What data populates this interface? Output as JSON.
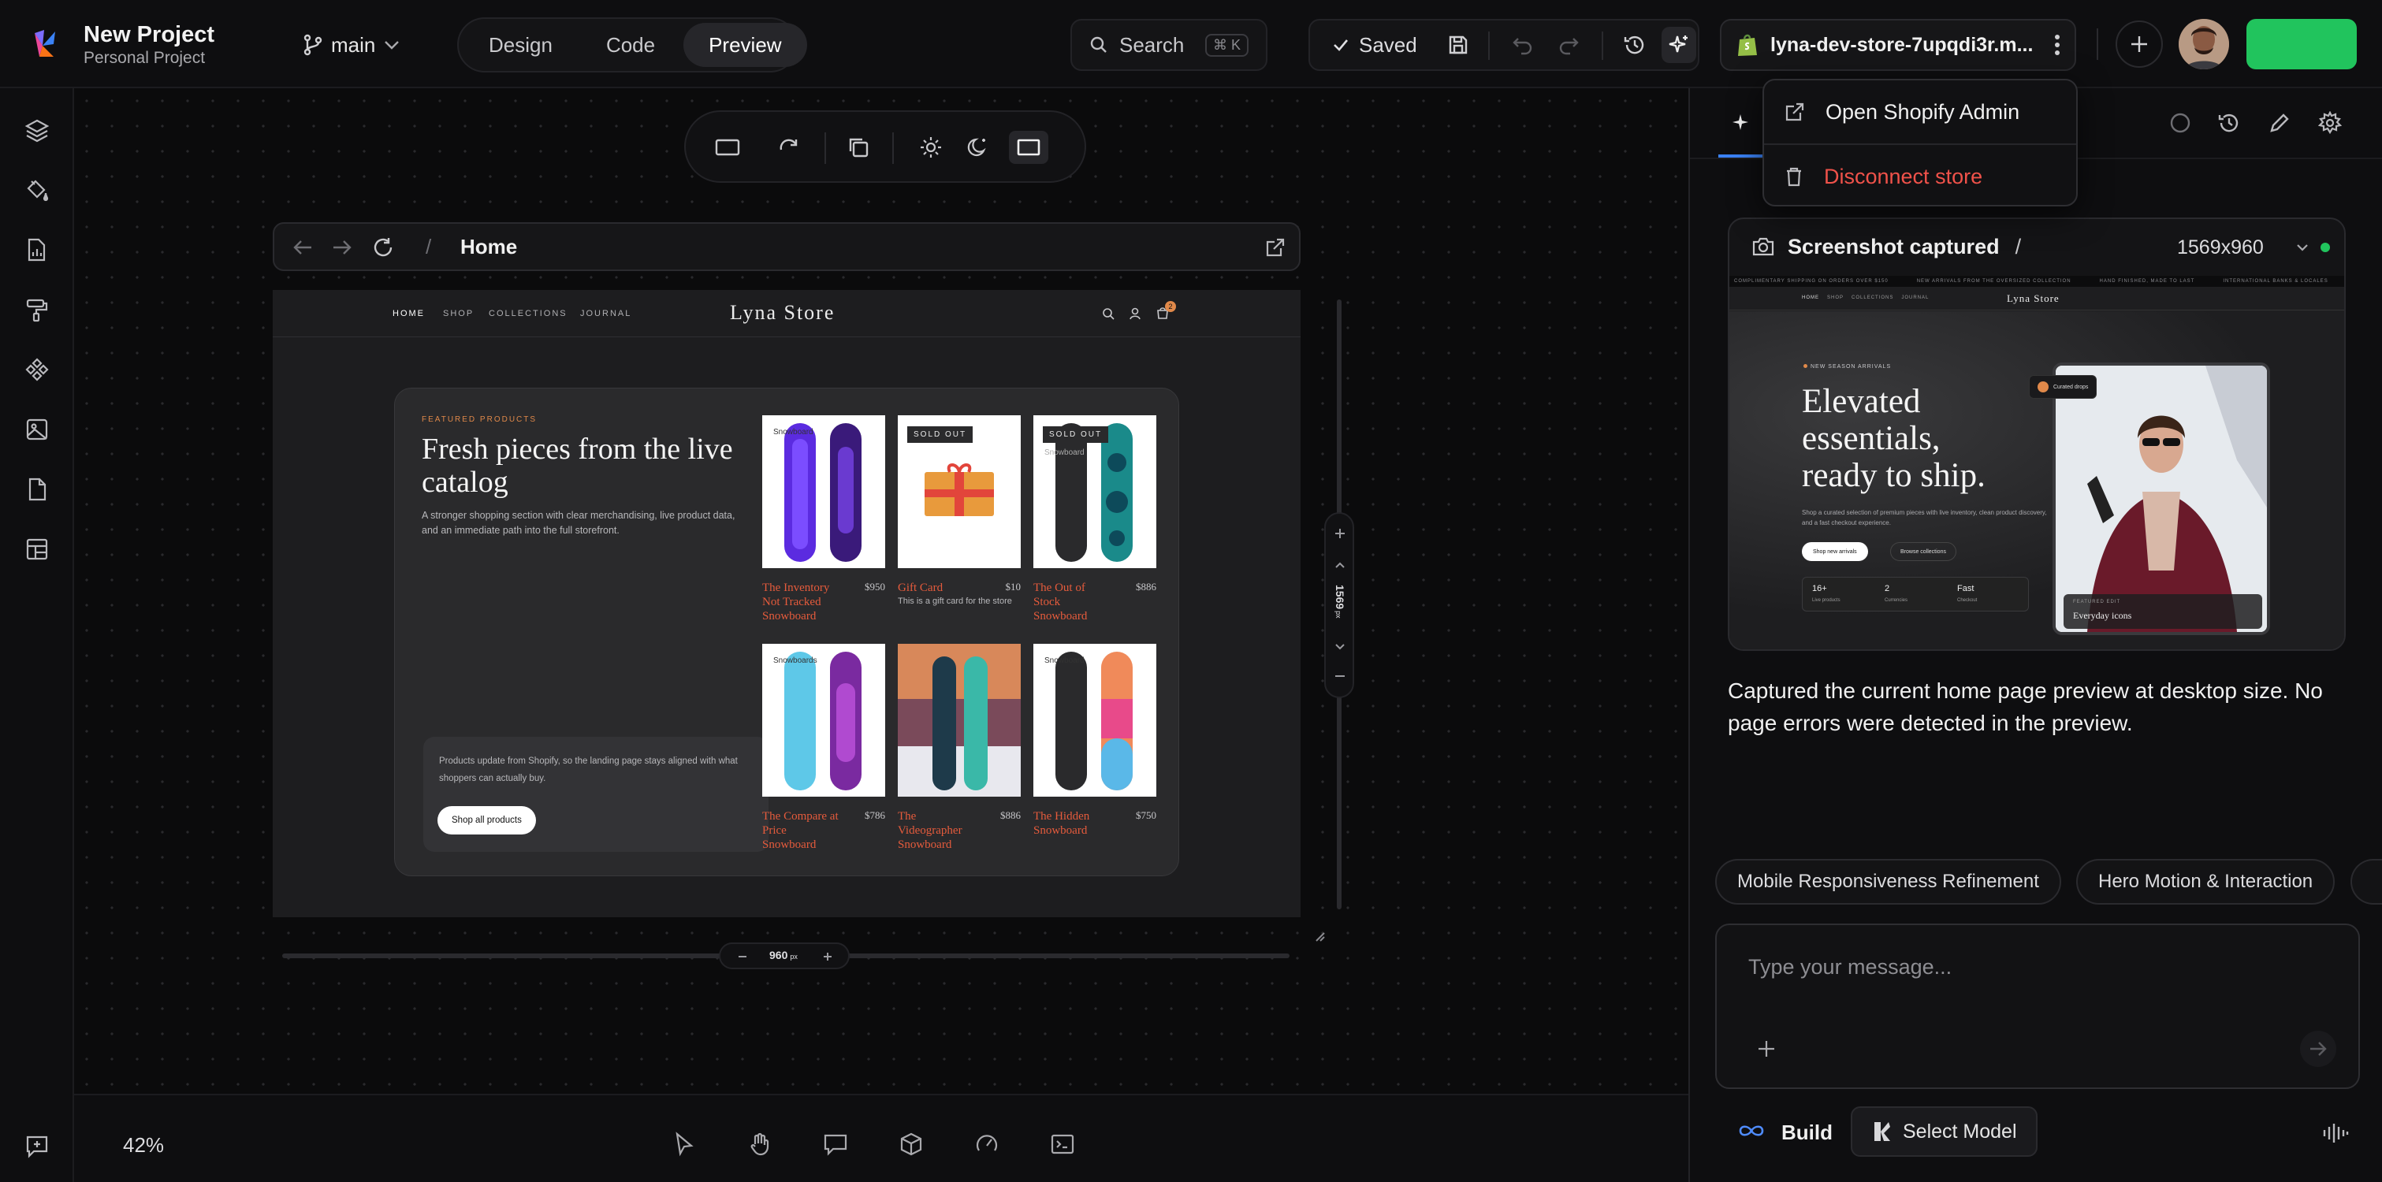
{
  "project": {
    "title": "New Project",
    "subtitle": "Personal Project"
  },
  "branch": {
    "name": "main"
  },
  "view_modes": [
    {
      "label": "Design"
    },
    {
      "label": "Code"
    },
    {
      "label": "Preview",
      "active": true
    }
  ],
  "search": {
    "label": "Search",
    "shortcut": "⌘ K"
  },
  "status": {
    "saved_label": "Saved"
  },
  "store": {
    "name": "lyna-dev-store-7upqdi3r.m..."
  },
  "dropdown": {
    "open_admin": "Open Shopify Admin",
    "disconnect": "Disconnect store",
    "danger_color": "#f0524a"
  },
  "accent": {
    "green": "#21c45d",
    "blue": "#3b82f6"
  },
  "preview": {
    "path": "Home",
    "width_label": "960",
    "width_unit": "px",
    "height_label": "1569",
    "height_unit": "px",
    "site": {
      "nav": [
        "HOME",
        "SHOP",
        "COLLECTIONS",
        "JOURNAL"
      ],
      "brand": "Lyna Store",
      "cart_count": "2",
      "eyebrow": "FEATURED PRODUCTS",
      "heading": "Fresh pieces from the live catalog",
      "description": "A stronger shopping section with clear merchandising, live product data, and an immediate path into the full storefront.",
      "note": "Products update from Shopify, so the landing page stays aligned with what shoppers can actually buy.",
      "note_button": "Shop all products",
      "products": [
        {
          "title": "The Inventory Not Tracked Snowboard",
          "price": "$950",
          "label": "Snowboard"
        },
        {
          "title": "Gift Card",
          "price": "$10",
          "subtitle": "This is a gift card for the store",
          "badge": "SOLD OUT"
        },
        {
          "title": "The Out of Stock Snowboard",
          "price": "$886",
          "badge": "SOLD OUT",
          "label": "Snowboard"
        },
        {
          "title": "The Compare at Price Snowboard",
          "price": "$786",
          "label": "Snowboards"
        },
        {
          "title": "The Videographer Snowboard",
          "price": "$886"
        },
        {
          "title": "The Hidden Snowboard",
          "price": "$750",
          "label": "Snowboard"
        }
      ]
    }
  },
  "canvas": {
    "zoom": "42%"
  },
  "panel": {
    "screenshot": {
      "title": "Screenshot captured",
      "dims": "1569x960"
    },
    "thumbnail": {
      "announcements": [
        "COMPLIMENTARY SHIPPING ON ORDERS OVER $150",
        "NEW ARRIVALS FROM THE OVERSIZED COLLECTION",
        "HAND FINISHED, MADE TO LAST",
        "INTERNATIONAL BANKS & LOCALES"
      ],
      "nav": [
        "HOME",
        "SHOP",
        "COLLECTIONS",
        "JOURNAL"
      ],
      "brand": "Lyna Store",
      "eyebrow": "NEW SEASON ARRIVALS",
      "headline": "Elevated essentials, ready to ship.",
      "body": "Shop a curated selection of premium pieces with live inventory, clean product discovery, and a fast checkout experience.",
      "primary_cta": "Shop new arrivals",
      "secondary_cta": "Browse collections",
      "stats": [
        {
          "value": "16+",
          "label": "Live products"
        },
        {
          "value": "2",
          "label": "Currencies"
        },
        {
          "value": "Fast",
          "label": "Checkout"
        }
      ],
      "floating_tag": "Curated drops",
      "featured_label": "FEATURED EDIT",
      "featured_title": "Everyday icons"
    },
    "message": "Captured the current home page preview at desktop size. No page errors were detected in the preview.",
    "suggestions": [
      "Mobile Responsiveness Refinement",
      "Hero Motion & Interaction"
    ],
    "composer": {
      "placeholder": "Type your message..."
    },
    "footer": {
      "build": "Build",
      "select_model": "Select Model"
    }
  }
}
